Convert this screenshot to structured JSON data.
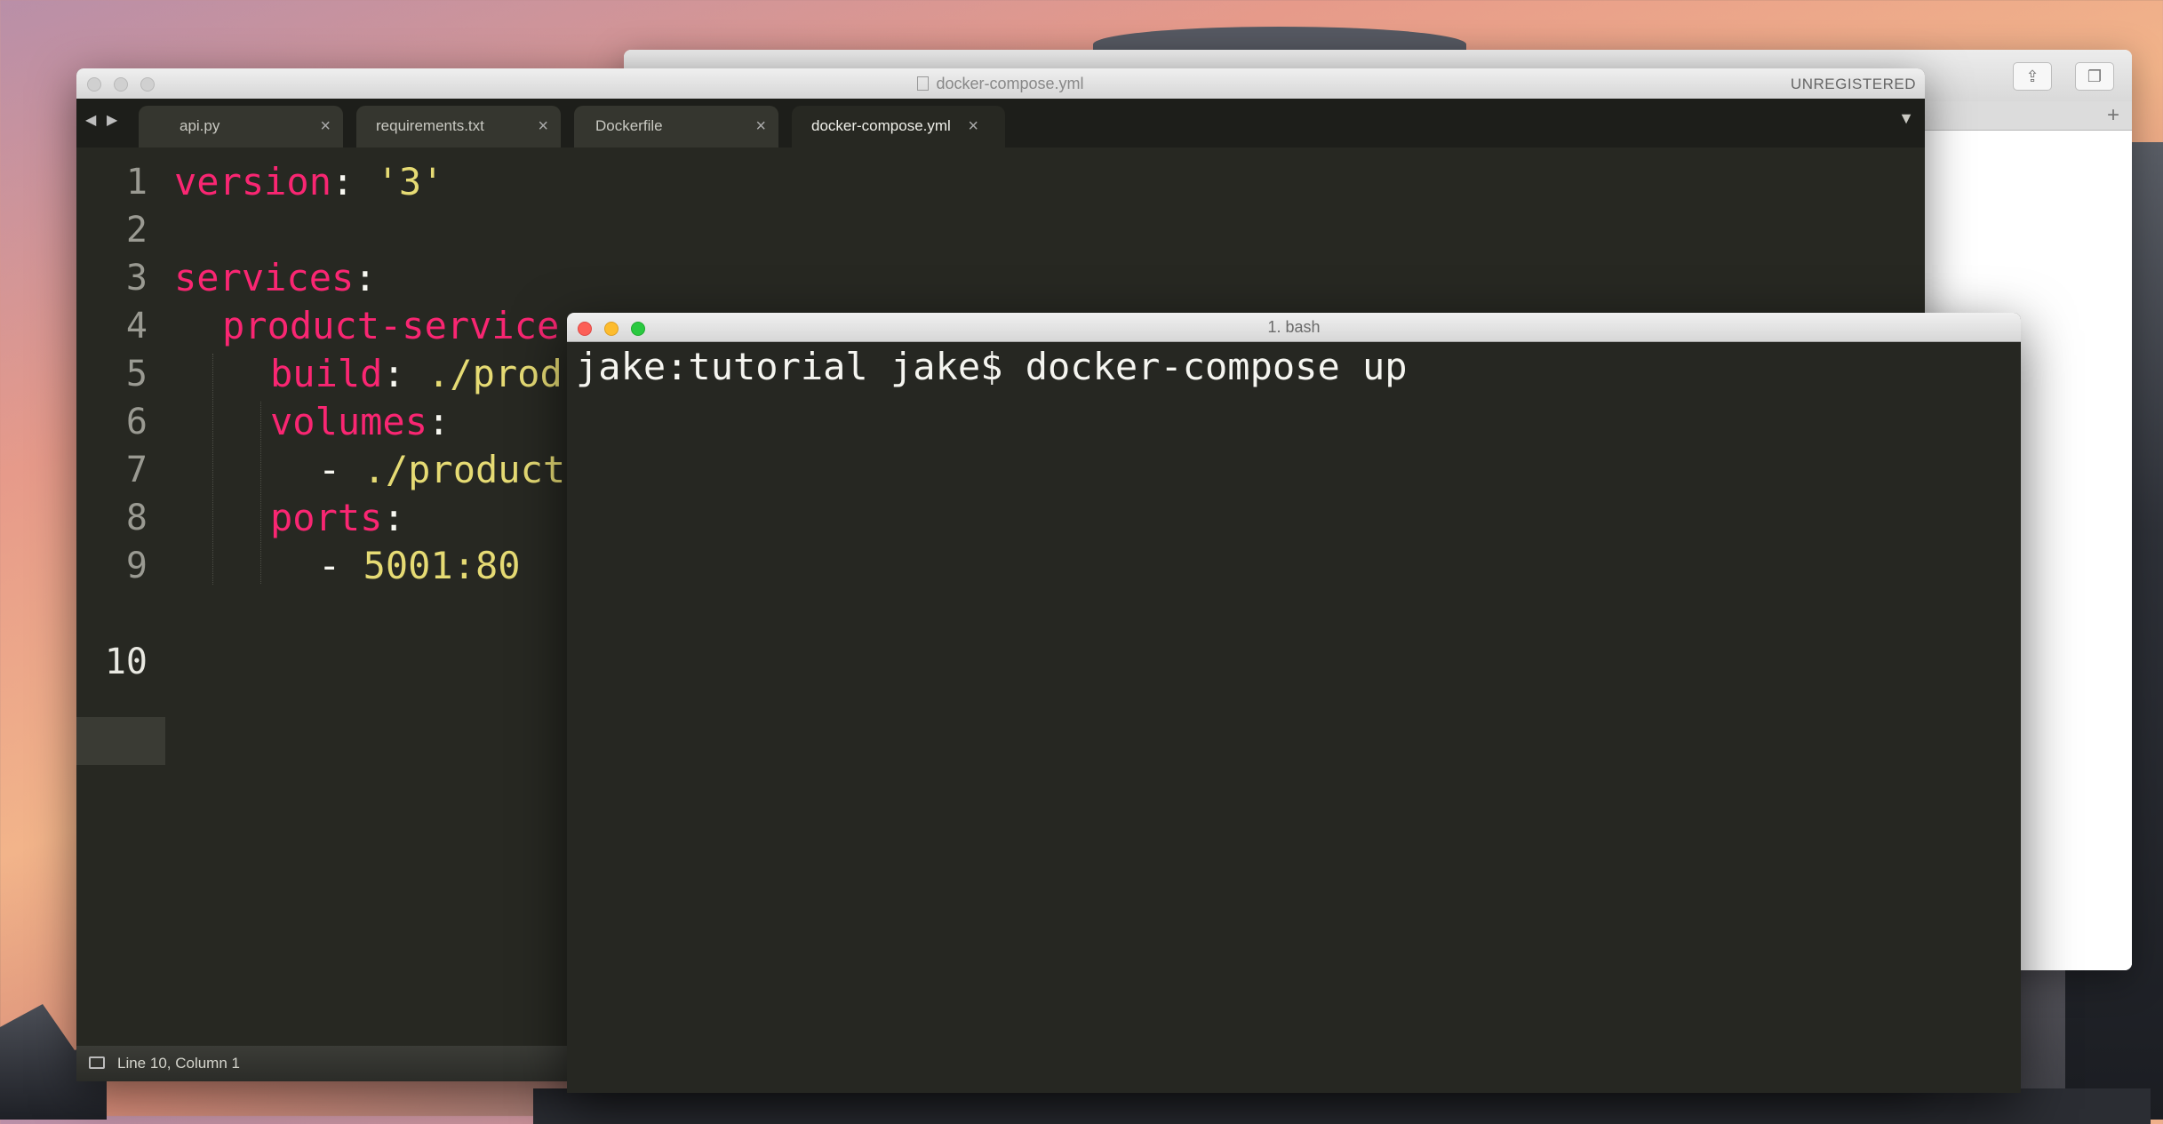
{
  "browser": {
    "new_tab_symbol": "+"
  },
  "editor": {
    "window_title": "docker-compose.yml",
    "unregistered_label": "UNREGISTERED",
    "tabs": [
      {
        "label": "api.py",
        "close": "×",
        "active": false
      },
      {
        "label": "requirements.txt",
        "close": "×",
        "active": false
      },
      {
        "label": "Dockerfile",
        "close": "×",
        "active": false
      },
      {
        "label": "docker-compose.yml",
        "close": "×",
        "active": true
      }
    ],
    "nav_back": "◀",
    "nav_forward": "▶",
    "tab_menu": "▼",
    "line_numbers": [
      "1",
      "2",
      "3",
      "4",
      "5",
      "6",
      "7",
      "8",
      "9",
      "10"
    ],
    "current_line": "10",
    "code": {
      "l1_key": "version",
      "l1_colon": ": ",
      "l1_val": "'3'",
      "l3_key": "services",
      "l3_colon": ":",
      "l4_key": "product-service",
      "l4_colon": ":",
      "l5_key": "build",
      "l5_colon": ": ",
      "l5_val": "./prod",
      "l6_key": "volumes",
      "l6_colon": ":",
      "l7_dash": "- ",
      "l7_val": "./product",
      "l8_key": "ports",
      "l8_colon": ":",
      "l9_dash": "- ",
      "l9_val": "5001:80"
    },
    "status": "Line 10, Column 1"
  },
  "terminal": {
    "title": "1. bash",
    "prompt": "jake:tutorial jake$ docker-compose up"
  }
}
